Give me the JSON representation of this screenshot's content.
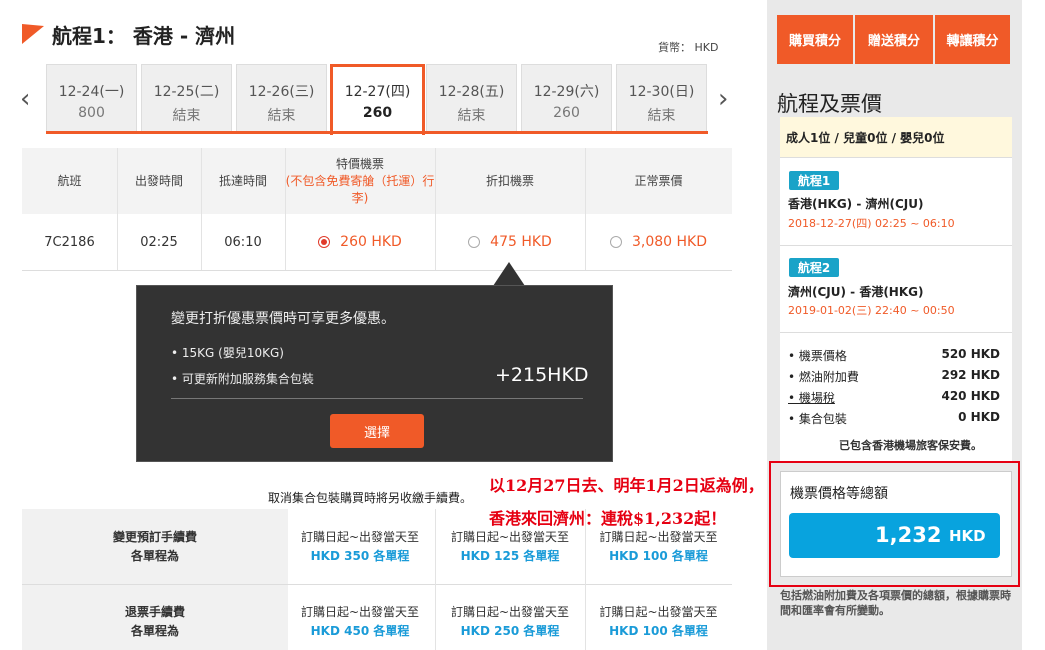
{
  "header": {
    "title": "航程1： 香港 - 濟州",
    "currency": "貨幣： HKD"
  },
  "dates": [
    {
      "date": "12-24(一)",
      "price": "800"
    },
    {
      "date": "12-25(二)",
      "price": "結束"
    },
    {
      "date": "12-26(三)",
      "price": "結束"
    },
    {
      "date": "12-27(四)",
      "price": "260"
    },
    {
      "date": "12-28(五)",
      "price": "結束"
    },
    {
      "date": "12-29(六)",
      "price": "260"
    },
    {
      "date": "12-30(日)",
      "price": "結束"
    }
  ],
  "fare_table": {
    "headers": {
      "flight": "航班",
      "depart": "出發時間",
      "arrive": "抵達時間",
      "special": "特價機票",
      "special_note": "(不包含免費寄艙（托運）行李)",
      "discount": "折扣機票",
      "normal": "正常票價"
    },
    "row": {
      "flight": "7C2186",
      "depart": "02:25",
      "arrive": "06:10",
      "special": "260 HKD",
      "discount": "475 HKD",
      "normal": "3,080 HKD"
    }
  },
  "tooltip": {
    "message": "變更打折優惠票價時可享更多優惠。",
    "item1": "• 15KG (嬰兒10KG)",
    "item2": "• 可更新附加服務集合包裝",
    "extra": "+215HKD",
    "button": "選擇"
  },
  "annotation": {
    "line1": "以12月27日去、明年1月2日返為例，",
    "line2": "香港來回濟州：連稅$1,232起！"
  },
  "fees": {
    "cancel_note": "取消集合包裝購買時將另收繳手續費。",
    "change_label1": "變更預訂手續費",
    "change_label2": "各單程為",
    "refund_label1": "退票手續費",
    "refund_label2": "各單程為",
    "period": "訂購日起~出發當天至",
    "change": [
      "HKD 350 各單程",
      "HKD 125 各單程",
      "HKD 100 各單程"
    ],
    "refund": [
      "HKD 450 各單程",
      "HKD 250 各單程",
      "HKD 100 各單程"
    ]
  },
  "right_panel": {
    "buttons": [
      "購買積分",
      "贈送積分",
      "轉讓積分"
    ],
    "title": "航程及票價",
    "pax": "成人1位 / 兒童0位 / 嬰兒0位",
    "leg1": {
      "badge": "航程1",
      "route": "香港(HKG) - 濟州(CJU)",
      "time": "2018-12-27(四) 02:25 ~ 06:10"
    },
    "leg2": {
      "badge": "航程2",
      "route": "濟州(CJU) - 香港(HKG)",
      "time": "2019-01-02(三) 22:40 ~ 00:50"
    },
    "costs": [
      {
        "k": "• 機票價格",
        "v": "520 HKD"
      },
      {
        "k": "• 燃油附加費",
        "v": "292 HKD"
      },
      {
        "k": "• 機場稅",
        "v": "420 HKD"
      },
      {
        "k": "• 集合包裝",
        "v": "0 HKD"
      }
    ],
    "insurance": "已包含香港機場旅客保安費。",
    "total_label": "機票價格等總額",
    "total_amount": "1,232",
    "total_currency": "HKD",
    "footnote": "包括燃油附加費及各項票價的總額，根據購票時間和匯率會有所變動。"
  }
}
